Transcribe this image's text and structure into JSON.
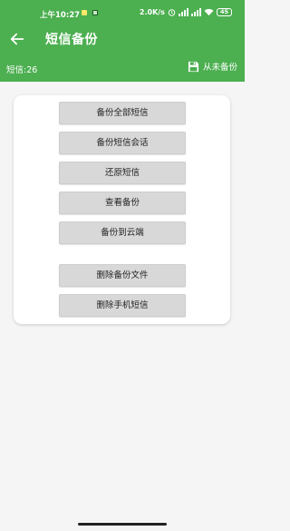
{
  "status_bar": {
    "time": "上午10:27",
    "net_speed": "2.0K/s",
    "battery": "45"
  },
  "app_bar": {
    "title": "短信备份",
    "back_icon": "arrow-left-icon"
  },
  "info_bar": {
    "sms_count": "短信:26",
    "backup_status": "从未备份",
    "backup_icon": "floppy-disk-icon"
  },
  "actions": {
    "backup_all": "备份全部短信",
    "backup_conversation": "备份短信会话",
    "restore": "还原短信",
    "view_backup": "查看备份",
    "backup_cloud": "备份到云端",
    "delete_backup_files": "删除备份文件",
    "delete_phone_sms": "删除手机短信"
  },
  "colors": {
    "primary": "#4caf50",
    "button_bg": "#d8d8d8",
    "page_bg": "#f5f5f5"
  }
}
